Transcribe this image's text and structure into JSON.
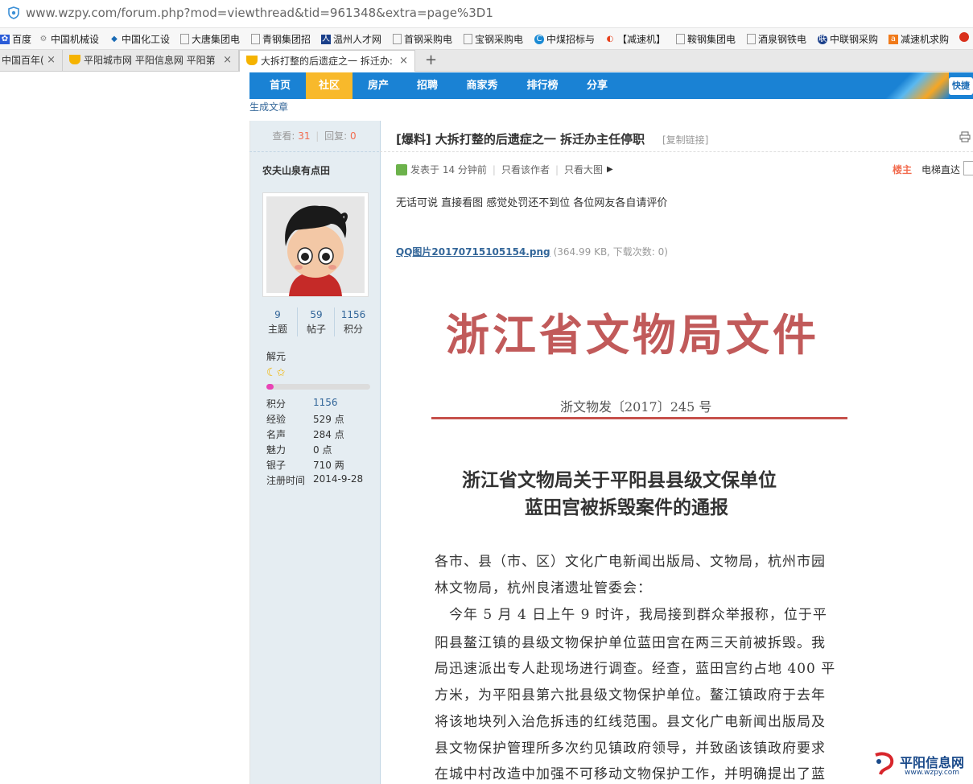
{
  "browser": {
    "url": "www.wzpy.com/forum.php?mod=viewthread&tid=961348&extra=page%3D1",
    "bookmarks": [
      "百度",
      "中国机械设",
      "中国化工设",
      "大唐集团电",
      "青钢集团招",
      "温州人才网",
      "首钢采购电",
      "宝钢采购电",
      "中煤招标与",
      "【减速机】",
      "鞍钢集团电",
      "酒泉钢铁电",
      "中联钢采购",
      "减速机求购"
    ],
    "tabs": [
      {
        "label": "中国百年(",
        "close": "×"
      },
      {
        "label": "平阳城市网 平阳信息网 平阳第",
        "close": "×"
      },
      {
        "label": "大拆打整的后遗症之一 拆迁办:",
        "close": "×"
      }
    ],
    "new_tab": "+"
  },
  "nav": {
    "items": [
      "首页",
      "社区",
      "房产",
      "招聘",
      "商家秀",
      "排行榜",
      "分享"
    ],
    "active": "社区",
    "quick": "快捷"
  },
  "breadcrumb": "生成文章",
  "thread": {
    "views_label": "查看:",
    "views": "31",
    "replies_label": "回复:",
    "replies": "0",
    "title": "[爆料] 大拆打整的后遗症之一 拆迁办主任停职",
    "copy_link": "[复制链接]",
    "posted": "发表于 14 分钟前",
    "only_author": "只看该作者",
    "only_image": "只看大图",
    "floor": "楼主",
    "elevator": "电梯直达",
    "content": "无话可说 直接看图 感觉处罚还不到位 各位网友各自请评价",
    "attachment_name": "QQ图片20170715105154.png",
    "attachment_meta": "(364.99 KB, 下载次数: 0)"
  },
  "author": {
    "name": "农夫山泉有点田",
    "counters": [
      {
        "value": "9",
        "label": "主题"
      },
      {
        "value": "59",
        "label": "帖子"
      },
      {
        "value": "1156",
        "label": "积分"
      }
    ],
    "rank": "解元",
    "level_progress": 0.07,
    "attributes": [
      {
        "label": "积分",
        "value": "1156"
      },
      {
        "label": "经验",
        "value": "529 点"
      },
      {
        "label": "名声",
        "value": "284 点"
      },
      {
        "label": "魅力",
        "value": "0 点"
      },
      {
        "label": "银子",
        "value": "710 两"
      },
      {
        "label": "注册时间",
        "value": "2014-9-28"
      }
    ]
  },
  "document": {
    "header": "浙江省文物局文件",
    "number": "浙文物发〔2017〕245 号",
    "heading_line1": "浙江省文物局关于平阳县县级文保单位",
    "heading_line2": "蓝田宫被拆毁案件的通报",
    "paragraph_lines": [
      "各市、县（市、区）文化广电新闻出版局、文物局，杭州市园",
      "林文物局，杭州良渚遗址管委会：",
      "　今年 5 月 4 日上午 9 时许，我局接到群众举报称，位于平",
      "阳县鳌江镇的县级文物保护单位蓝田宫在两三天前被拆毁。我",
      "局迅速派出专人赴现场进行调查。经查，蓝田宫约占地 400 平",
      "方米，为平阳县第六批县级文物保护单位。鳌江镇政府于去年",
      "将该地块列入治危拆违的红线范围。县文化广电新闻出版局及",
      "县文物保护管理所多次约见镇政府领导，并致函该镇政府要求",
      "在城中村改造中加强不可移动文物保护工作，并明确提出了蓝"
    ]
  },
  "watermark": {
    "name": "平阳信息网",
    "site": "www.wzpy.com"
  },
  "colors": {
    "nav_bg": "#1a82d4",
    "nav_active": "#f8b92b",
    "link": "#336699",
    "accent_red": "#f26c4f",
    "doc_red": "#c15a5a"
  }
}
